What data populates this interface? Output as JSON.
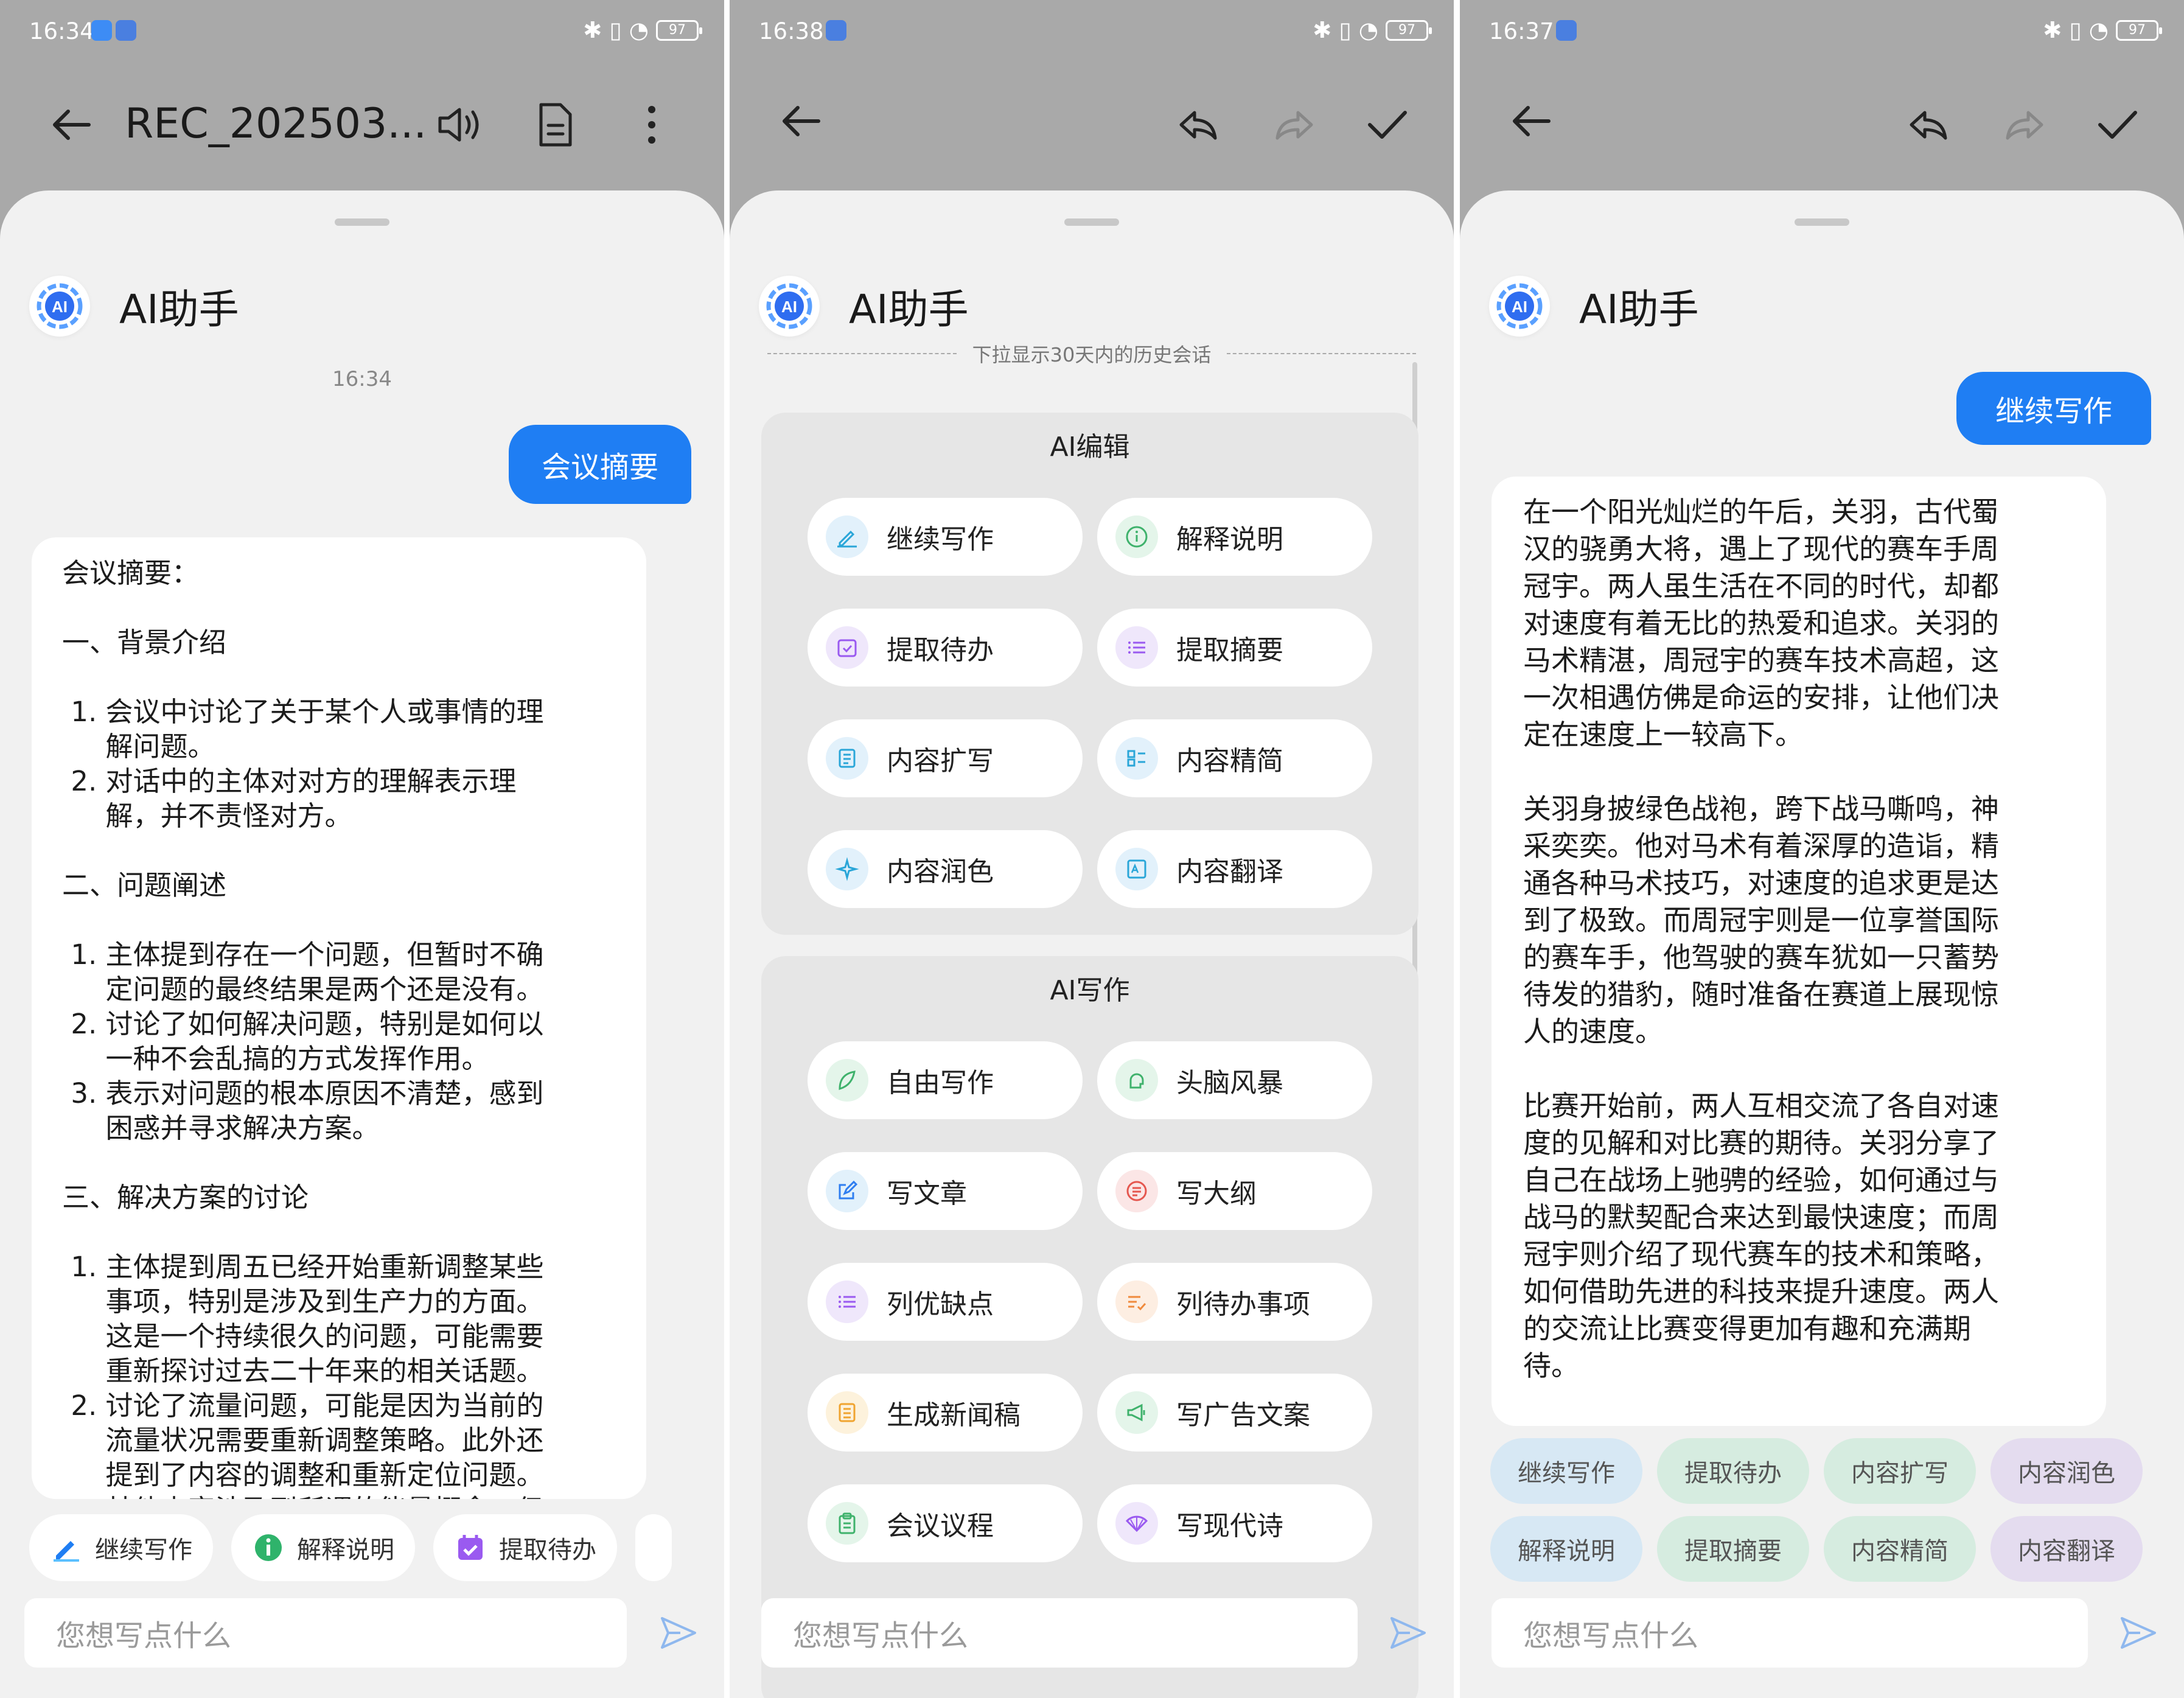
{
  "colors": {
    "accent": "#1f7ef3",
    "sheet": "#f1f1f1",
    "dim": "#a9a9a9"
  },
  "common": {
    "ai_title": "AI助手",
    "ai_logo_text": "AI",
    "input_placeholder": "您想写点什么",
    "battery": "97"
  },
  "panel1": {
    "status_time": "16:34",
    "file_title": "REC_202503...",
    "timestamp": "16:34",
    "user_message": "会议摘要",
    "answer_text": "会议摘要：\n\n一、背景介绍\n\n 1. 会议中讨论了关于某个人或事情的理\n     解问题。\n 2. 对话中的主体对对方的理解表示理\n     解，并不责怪对方。\n\n二、问题阐述\n\n 1. 主体提到存在一个问题，但暂时不确\n     定问题的最终结果是两个还是没有。\n 2. 讨论了如何解决问题，特别是如何以\n     一种不会乱搞的方式发挥作用。\n 3. 表示对问题的根本原因不清楚，感到\n     困惑并寻求解决方案。\n\n三、解决方案的讨论\n\n 1. 主体提到周五已经开始重新调整某些\n     事项，特别是涉及到生产力的方面。\n     这是一个持续很久的问题，可能需要\n     重新探讨过去二十年来的相关话题。\n 2. 讨论了流量问题，可能是因为当前的\n     流量状况需要重新调整策略。此外还\n     提到了内容的调整和重新定位问题。\n     其他内容涉及到所谓的能量概念，但",
    "chips": [
      "继续写作",
      "解释说明",
      "提取待办"
    ]
  },
  "panel2": {
    "status_time": "16:38",
    "history_hint": "下拉显示30天内的历史会话",
    "group1_title": "AI编辑",
    "group1_tools": [
      "继续写作",
      "解释说明",
      "提取待办",
      "提取摘要",
      "内容扩写",
      "内容精简",
      "内容润色",
      "内容翻译"
    ],
    "group2_title": "AI写作",
    "group2_tools": [
      "自由写作",
      "头脑风暴",
      "写文章",
      "写大纲",
      "列优缺点",
      "列待办事项",
      "生成新闻稿",
      "写广告文案",
      "会议议程",
      "写现代诗"
    ]
  },
  "panel3": {
    "status_time": "16:37",
    "user_message": "继续写作",
    "answer_text": "在一个阳光灿烂的午后，关羽，古代蜀\n汉的骁勇大将，遇上了现代的赛车手周\n冠宇。两人虽生活在不同的时代，却都\n对速度有着无比的热爱和追求。关羽的\n马术精湛，周冠宇的赛车技术高超，这\n一次相遇仿佛是命运的安排，让他们决\n定在速度上一较高下。\n\n关羽身披绿色战袍，跨下战马嘶鸣，神\n采奕奕。他对马术有着深厚的造诣，精\n通各种马术技巧，对速度的追求更是达\n到了极致。而周冠宇则是一位享誉国际\n的赛车手，他驾驶的赛车犹如一只蓄势\n待发的猎豹，随时准备在赛道上展现惊\n人的速度。\n\n比赛开始前，两人互相交流了各自对速\n度的见解和对比赛的期待。关羽分享了\n自己在战场上驰骋的经验，如何通过与\n战马的默契配合来达到最快速度；而周\n冠宇则介绍了现代赛车的技术和策略，\n如何借助先进的科技来提升速度。两人\n的交流让比赛变得更加有趣和充满期\n待。",
    "chips_row1": [
      "继续写作",
      "提取待办",
      "内容扩写",
      "内容润色"
    ],
    "chips_row2": [
      "解释说明",
      "提取摘要",
      "内容精简",
      "内容翻译"
    ]
  }
}
